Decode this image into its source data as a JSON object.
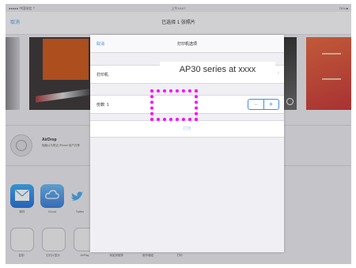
{
  "status_bar": {
    "carrier": "●●●●● 中国电信 ⇡",
    "time": "上午10:07",
    "battery": "75% ■"
  },
  "nav": {
    "cancel": "取消",
    "title": "已选择 1 张照片"
  },
  "airdrop": {
    "title": "AirDrop",
    "description": "轻触以与附近 iPhone 用户共享"
  },
  "share_apps": [
    {
      "label": "邮件",
      "icon": "mail-icon"
    },
    {
      "label": "iCloud",
      "icon": "icloud-icon"
    },
    {
      "label": "Twitter",
      "icon": "twitter-icon"
    }
  ],
  "actions": [
    {
      "label": "复制",
      "icon": "copy-icon"
    },
    {
      "label": "幻灯片显示",
      "icon": "slideshow-icon"
    },
    {
      "label": "AirPlay",
      "icon": "airplay-icon"
    },
    {
      "label": "添加到相簿",
      "icon": "album-icon"
    },
    {
      "label": "用作墙纸",
      "icon": "wallpaper-icon"
    },
    {
      "label": "打印",
      "icon": "print-icon"
    }
  ],
  "dialog": {
    "cancel": "取消",
    "title": "打印机选项",
    "printer_label": "打印机",
    "printer_name": "AP30 series at xxxx",
    "copies_label": "份数: 1",
    "minus": "−",
    "plus": "+",
    "print_button": "打印"
  },
  "colors": {
    "accent": "#3f8de4",
    "highlight": "#ff00ff"
  }
}
